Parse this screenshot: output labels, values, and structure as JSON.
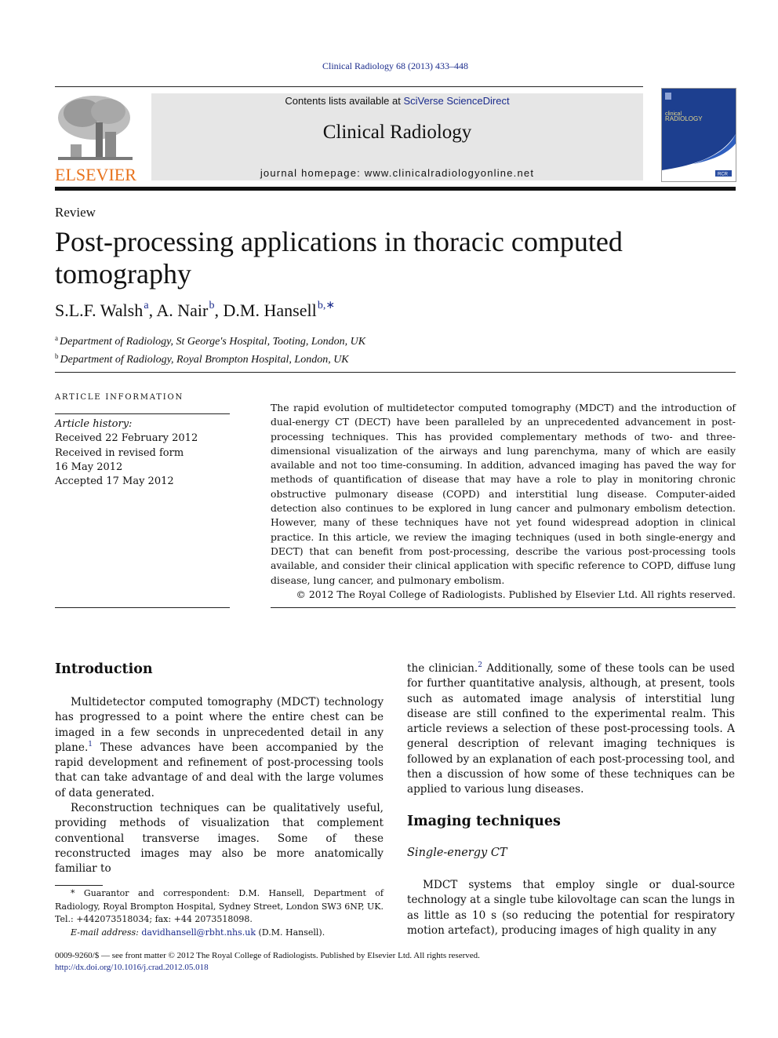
{
  "header": {
    "citation": "Clinical Radiology 68 (2013) 433–448",
    "publisher_logo_text": "ELSEVIER",
    "contents_prefix": "Contents lists available at ",
    "contents_link": "SciVerse ScienceDirect",
    "journal_name": "Clinical Radiology",
    "homepage": "journal homepage: www.clinicalradiologyonline.net",
    "cover": {
      "line1": "clinical",
      "line2": "RADIOLOGY",
      "badge": "RCR"
    }
  },
  "colors": {
    "link": "#1a2b8c",
    "elsevier_orange": "#e8731e",
    "header_gray": "#e6e6e6",
    "cover_blue": "#1d3f8f"
  },
  "article": {
    "type_label": "Review",
    "title": "Post-processing applications in thoracic computed tomography",
    "authors": [
      {
        "name": "S.L.F. Walsh",
        "sup": "a"
      },
      {
        "name": "A. Nair",
        "sup": "b"
      },
      {
        "name": "D.M. Hansell",
        "sup": "b,∗"
      }
    ],
    "affiliations": [
      {
        "sup": "a",
        "text": "Department of Radiology, St George's Hospital, Tooting, London, UK"
      },
      {
        "sup": "b",
        "text": "Department of Radiology, Royal Brompton Hospital, London, UK"
      }
    ]
  },
  "article_info": {
    "heading": "ARTICLE INFORMATION",
    "history_label": "Article history:",
    "history": [
      "Received 22 February 2012",
      "Received in revised form",
      "16 May 2012",
      "Accepted 17 May 2012"
    ]
  },
  "abstract": {
    "text": "The rapid evolution of multidetector computed tomography (MDCT) and the introduction of dual-energy CT (DECT) have been paralleled by an unprecedented advancement in post-processing techniques. This has provided complementary methods of two- and three-dimensional visualization of the airways and lung parenchyma, many of which are easily available and not too time-consuming. In addition, advanced imaging has paved the way for methods of quantification of disease that may have a role to play in monitoring chronic obstructive pulmonary disease (COPD) and interstitial lung disease. Computer-aided detection also continues to be explored in lung cancer and pulmonary embolism detection. However, many of these techniques have not yet found widespread adoption in clinical practice. In this article, we review the imaging techniques (used in both single-energy and DECT) that can benefit from post-processing, describe the various post-processing tools available, and consider their clinical application with specific reference to COPD, diffuse lung disease, lung cancer, and pulmonary embolism.",
    "copyright": "© 2012 The Royal College of Radiologists. Published by Elsevier Ltd. All rights reserved."
  },
  "body": {
    "intro_heading": "Introduction",
    "intro_p1_a": "Multidetector computed tomography (MDCT) technology has progressed to a point where the entire chest can be imaged in a few seconds in unprecedented detail in any plane.",
    "intro_p1_ref": "1",
    "intro_p1_b": " These advances have been accompanied by the rapid development and refinement of post-processing tools that can take advantage of and deal with the large volumes of data generated.",
    "intro_p2": "Reconstruction techniques can be qualitatively useful, providing methods of visualization that complement conventional transverse images. Some of these reconstructed images may also be more anatomically familiar to",
    "right_p1_a": "the clinician.",
    "right_p1_ref": "2",
    "right_p1_b": " Additionally, some of these tools can be used for further quantitative analysis, although, at present, tools such as automated image analysis of interstitial lung disease are still confined to the experimental realm. This article reviews a selection of these post-processing tools. A general description of relevant imaging techniques is followed by an explanation of each post-processing tool, and then a discussion of how some of these techniques can be applied to various lung diseases.",
    "imaging_heading": "Imaging techniques",
    "single_energy_heading": "Single-energy CT",
    "single_energy_p1": "MDCT systems that employ single or dual-source technology at a single tube kilovoltage can scan the lungs in as little as 10 s (so reducing the potential for respiratory motion artefact), producing images of high quality in any"
  },
  "footnote": {
    "marker": "*",
    "text": " Guarantor and correspondent: D.M. Hansell, Department of Radiology, Royal Brompton Hospital, Sydney Street, London SW3 6NP, UK. Tel.: +442073518034; fax: +44 2073518098.",
    "email_label": "E-mail address: ",
    "email": "davidhansell@rbht.nhs.uk",
    "email_suffix": " (D.M. Hansell)."
  },
  "bottom": {
    "issn_line": "0009-9260/$ — see front matter © 2012 The Royal College of Radiologists. Published by Elsevier Ltd. All rights reserved.",
    "doi": "http://dx.doi.org/10.1016/j.crad.2012.05.018"
  }
}
